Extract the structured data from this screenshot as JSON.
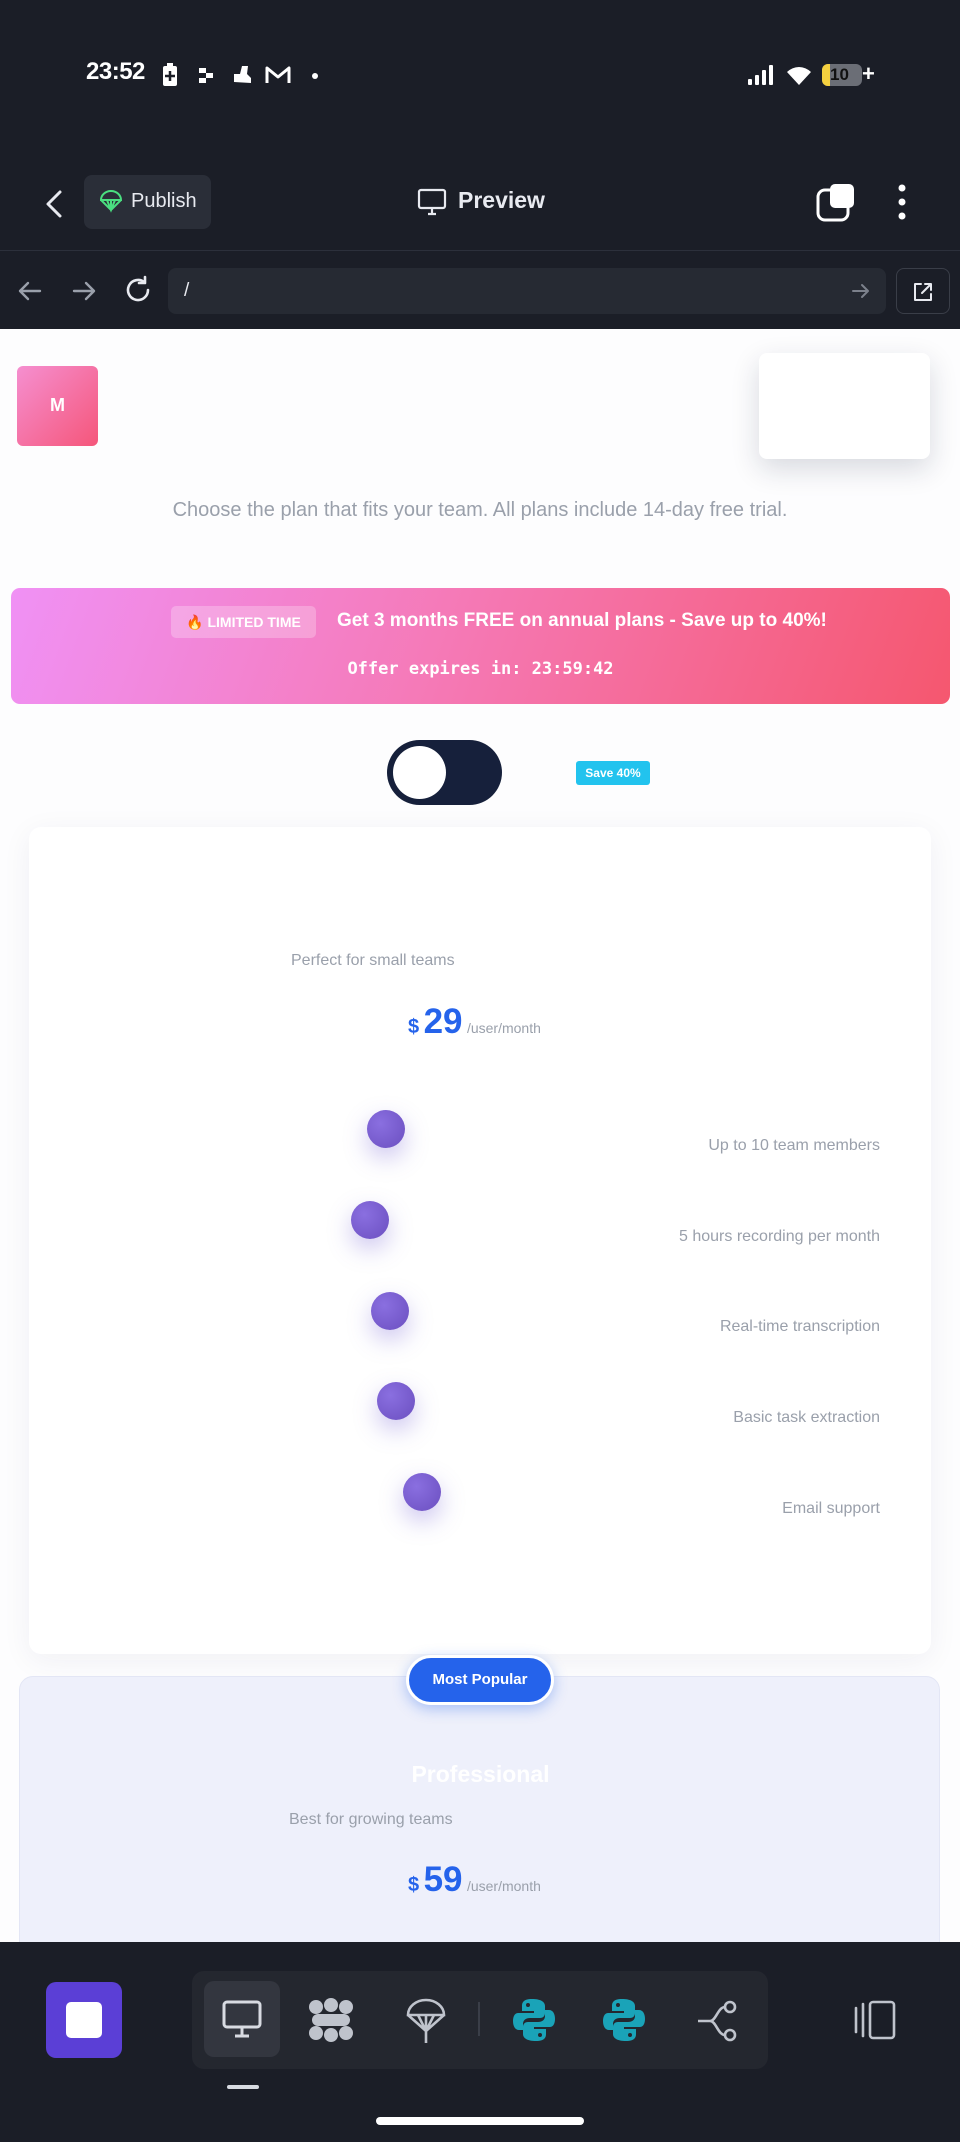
{
  "status_bar": {
    "time": "23:52",
    "battery": "10"
  },
  "app_header": {
    "publish_label": "Publish",
    "preview_label": "Preview"
  },
  "url_bar": {
    "path": "/"
  },
  "page": {
    "logo_letter": "M",
    "subtitle": "Choose the plan that fits your team. All plans include 14-day free trial.",
    "promo": {
      "badge": "🔥 LIMITED TIME",
      "headline": "Get 3 months FREE on annual plans - Save up to 40%!",
      "countdown": "Offer expires in: 23:59:42"
    },
    "toggle": {
      "save_badge": "Save 40%",
      "state": "off"
    },
    "plans": [
      {
        "name": "",
        "description": "Perfect for small teams",
        "currency": "$",
        "price": "29",
        "period": "/user/month",
        "features": [
          "Up to 10 team members",
          "5 hours recording per month",
          "Real-time transcription",
          "Basic task extraction",
          "Email support"
        ]
      },
      {
        "badge": "Most Popular",
        "name": "Professional",
        "description": "Best for growing teams",
        "currency": "$",
        "price": "59",
        "period": "/user/month"
      }
    ]
  },
  "colors": {
    "dark_bg": "#1b1e27",
    "accent_blue": "#2563eb",
    "promo_start": "#f091f5",
    "promo_end": "#f55a78",
    "save_badge": "#22c3ee",
    "toggle_bg": "#16203b",
    "stop_button": "#5b3fd6",
    "python_icon": "#1aa3b8"
  },
  "icons": {
    "status_bar": [
      "battery-saver-icon",
      "dots-app-icon",
      "shoe-app-icon",
      "gmail-icon",
      "dot-icon",
      "signal-icon",
      "wifi-icon",
      "battery-icon"
    ],
    "header": [
      "back-chevron-icon",
      "parachute-icon",
      "monitor-icon",
      "tabs-icon",
      "more-vertical-icon"
    ],
    "url_bar": [
      "arrow-left-icon",
      "arrow-right-icon",
      "refresh-icon",
      "go-arrow-icon",
      "open-external-icon"
    ],
    "bottom_bar": [
      "stop-icon",
      "monitor-icon",
      "brain-icon",
      "parachute-icon",
      "python-icon",
      "python-icon",
      "branch-icon",
      "panel-icon"
    ]
  }
}
